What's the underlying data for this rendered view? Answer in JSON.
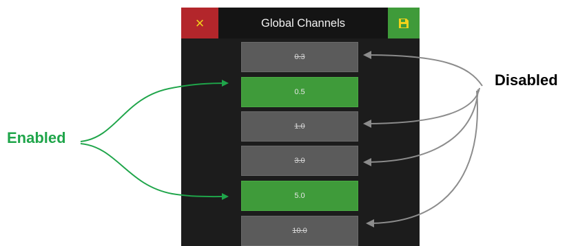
{
  "header": {
    "title": "Global Channels",
    "close_icon": "×",
    "save_icon": "save-icon"
  },
  "channels": [
    {
      "label": "0.3",
      "enabled": false
    },
    {
      "label": "0.5",
      "enabled": true
    },
    {
      "label": "1.0",
      "enabled": false
    },
    {
      "label": "3.0",
      "enabled": false
    },
    {
      "label": "5.0",
      "enabled": true
    },
    {
      "label": "10.0",
      "enabled": false
    }
  ],
  "annotations": {
    "enabled": "Enabled",
    "disabled": "Disabled"
  },
  "colors": {
    "enabled_green": "#3f9b3a",
    "disabled_gray": "#5b5b5b",
    "close_red": "#b3262b",
    "annotation_green": "#1fa54a",
    "annotation_gray": "#8c8c8c"
  }
}
